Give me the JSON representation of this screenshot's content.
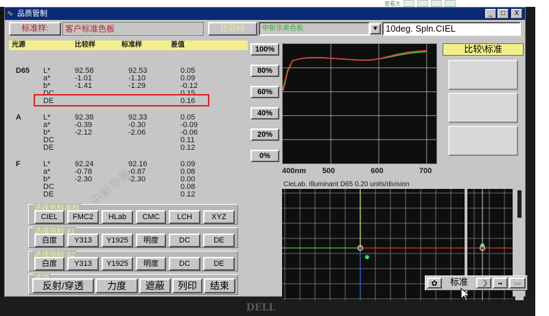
{
  "window": {
    "title": "品质管制",
    "controls": {
      "minimize": "_",
      "maximize": "□",
      "close": "X"
    }
  },
  "toolbar": {
    "standard_label": "标准样:",
    "standard_value": "客户标准色板",
    "sample_label": "比较样",
    "sample_value": "中新华美色板",
    "observer_value": "10deg. Spln.CIEL",
    "dropdown_arrow": "▼"
  },
  "table": {
    "headers": [
      "光源",
      "比较样",
      "标准样",
      "差值"
    ],
    "groups": [
      {
        "illuminant": "D65",
        "rows": [
          {
            "label": "L*",
            "sample": "92.58",
            "standard": "92.53",
            "diff": "0.05"
          },
          {
            "label": "a*",
            "sample": "-1.01",
            "standard": "-1.10",
            "diff": "0.09"
          },
          {
            "label": "b*",
            "sample": "-1.41",
            "standard": "-1.29",
            "diff": "-0.12"
          },
          {
            "label": "DC",
            "sample": "",
            "standard": "",
            "diff": "0.15"
          },
          {
            "label": "DE",
            "sample": "",
            "standard": "",
            "diff": "0.16"
          }
        ]
      },
      {
        "illuminant": "A",
        "rows": [
          {
            "label": "L*",
            "sample": "92.38",
            "standard": "92.33",
            "diff": "0.05"
          },
          {
            "label": "a*",
            "sample": "-0.39",
            "standard": "-0.30",
            "diff": "-0.09"
          },
          {
            "label": "b*",
            "sample": "-2.12",
            "standard": "-2.06",
            "diff": "-0.06"
          },
          {
            "label": "DC",
            "sample": "",
            "standard": "",
            "diff": "0.11"
          },
          {
            "label": "DE",
            "sample": "",
            "standard": "",
            "diff": "0.12"
          }
        ]
      },
      {
        "illuminant": "F",
        "rows": [
          {
            "label": "L*",
            "sample": "92.24",
            "standard": "92.16",
            "diff": "0.09"
          },
          {
            "label": "a*",
            "sample": "-0.78",
            "standard": "-0.87",
            "diff": "0.08"
          },
          {
            "label": "b*",
            "sample": "-2.30",
            "standard": "-2.30",
            "diff": "0.00"
          },
          {
            "label": "DC",
            "sample": "",
            "standard": "",
            "diff": "0.08"
          },
          {
            "label": "DE",
            "sample": "",
            "standard": "",
            "diff": "0.12"
          }
        ]
      }
    ]
  },
  "spectrum": {
    "percent_buttons": [
      "100%",
      "80%",
      "60%",
      "40%",
      "20%",
      "0%"
    ],
    "x_ticks": [
      "400nm",
      "500",
      "600",
      "700"
    ],
    "colors": {
      "sample": "#30d030",
      "standard": "#e84040",
      "grid": "#9a9a9a"
    },
    "chart_data": {
      "type": "line",
      "x": [
        400,
        410,
        420,
        440,
        460,
        480,
        500,
        520,
        540,
        560,
        580,
        600,
        620,
        640,
        660,
        680,
        700
      ],
      "series": [
        {
          "values": [
            62,
            78,
            86,
            88,
            88.5,
            88.5,
            88,
            87.5,
            87,
            86.5,
            86.5,
            87.5,
            89,
            90.5,
            92,
            93,
            93.5
          ]
        },
        {
          "values": [
            60,
            77,
            86,
            88,
            88.5,
            88.5,
            88,
            87.5,
            87,
            86.5,
            86.5,
            87.5,
            89.5,
            91.5,
            93,
            94,
            94.5
          ]
        }
      ],
      "xlim": [
        400,
        720
      ],
      "ylim": [
        0,
        100
      ]
    }
  },
  "compare_panel": {
    "title": "比较\\标准"
  },
  "lab_plot": {
    "label": "CieLab. Illuminant D65   0.20 units/division",
    "axis_colors": {
      "a": "#e03030",
      "b_pos": "#e8e040",
      "b_neg": "#3070e0",
      "l_pos": "#40d040"
    },
    "points": [
      {
        "a": 0.0,
        "b": 0.0
      },
      {
        "a": 0.09,
        "b": -0.12
      }
    ]
  },
  "std_toolbar": {
    "label": "标准",
    "moon": "☽",
    "dots": "••",
    "wave": "≈≈"
  },
  "button_groups": {
    "group1": {
      "title": "选择色标准样",
      "buttons": [
        "CIEL",
        "FMC2",
        "HLab",
        "CMC",
        "LCH",
        "XYZ"
      ]
    },
    "group2": {
      "title": "选择指标 #1",
      "buttons": [
        "白度",
        "Y313",
        "Y1925",
        "明度",
        "DC",
        "DE"
      ]
    },
    "group3": {
      "title": "选择指标 #2",
      "buttons": [
        "白度",
        "Y313",
        "Y1925",
        "明度",
        "DC",
        "DE"
      ]
    },
    "group4": {
      "title": "选项",
      "buttons": [
        "反射/穿透",
        "力度",
        "遮蔽",
        "列印",
        "结束"
      ]
    }
  },
  "watermark": "中新华美",
  "monitor_brand": "DELL",
  "browser_toolbar_label": "查看大"
}
